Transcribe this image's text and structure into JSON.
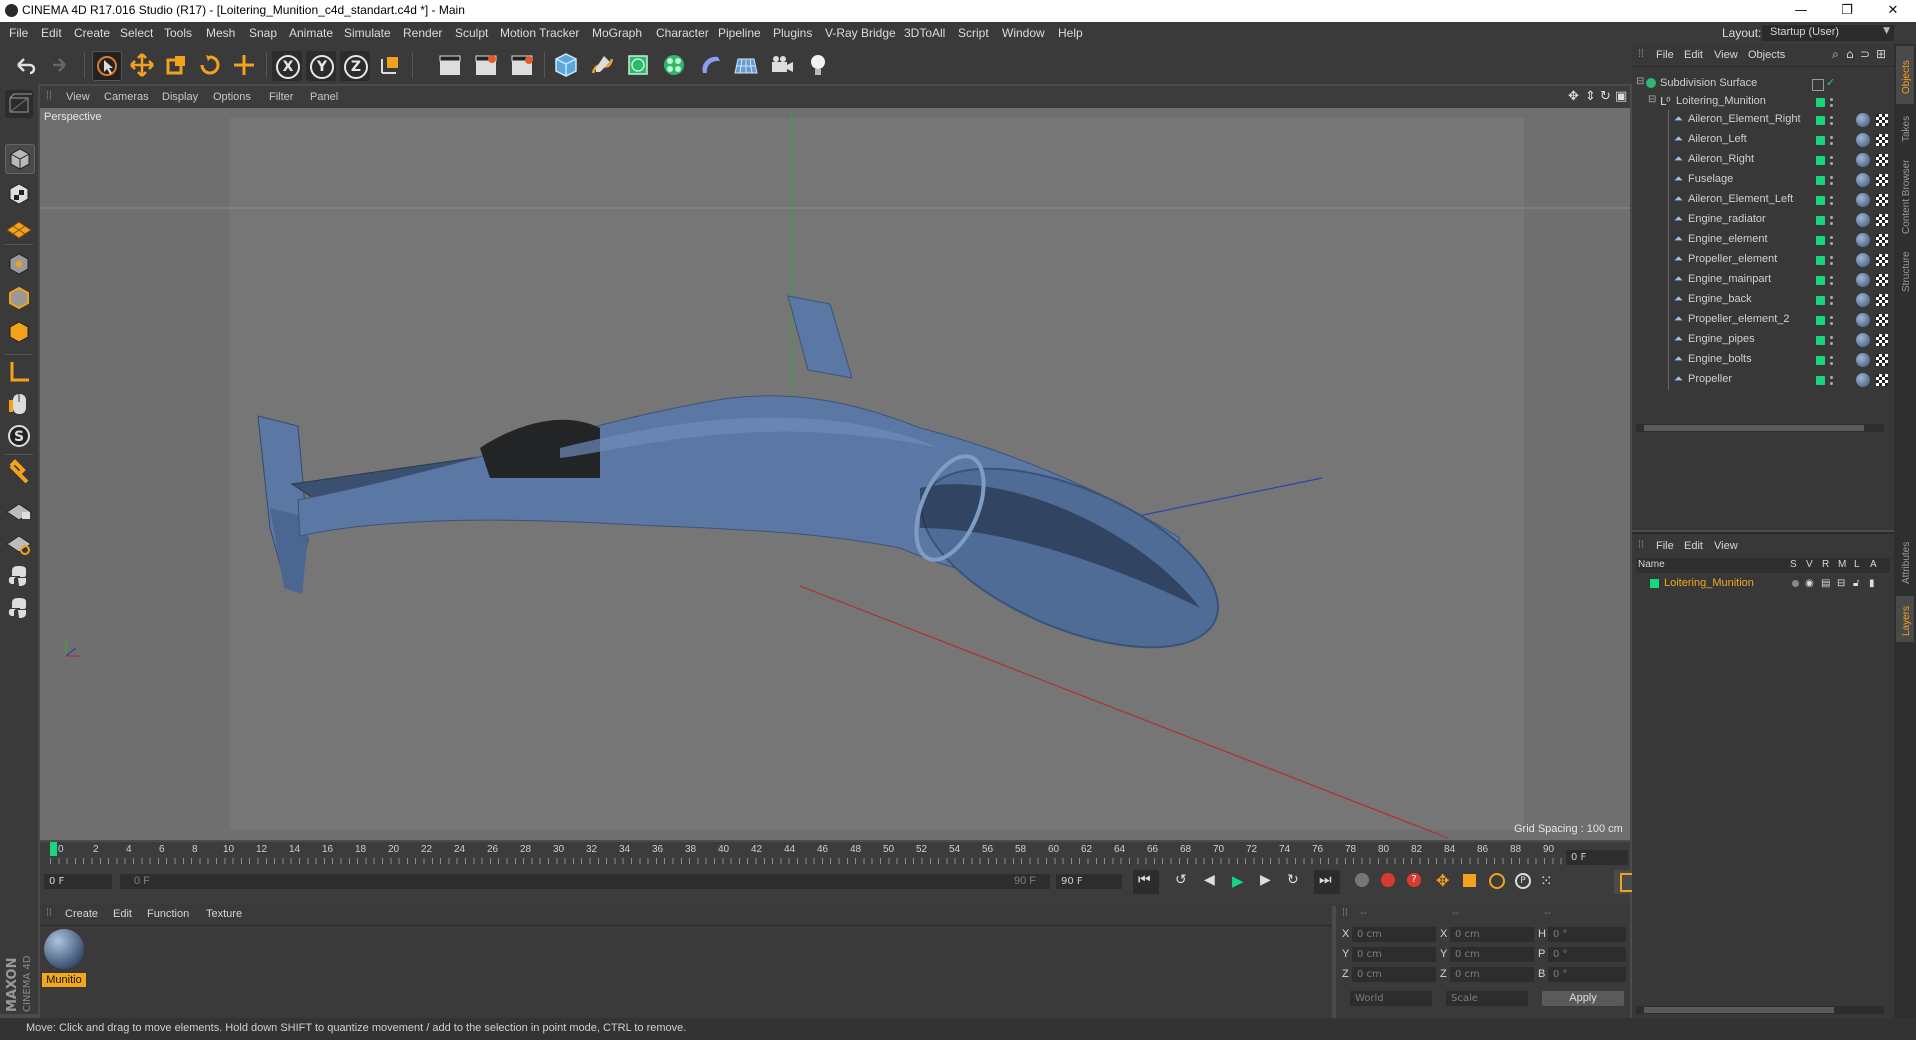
{
  "window": {
    "title": "CINEMA 4D R17.016 Studio (R17) - [Loitering_Munition_c4d_standart.c4d *] - Main",
    "controls": [
      "—",
      "❐",
      "✕"
    ]
  },
  "menubar": {
    "items": [
      "File",
      "Edit",
      "Create",
      "Select",
      "Tools",
      "Mesh",
      "Snap",
      "Animate",
      "Simulate",
      "Render",
      "Sculpt",
      "Motion Tracker",
      "MoGraph",
      "Character",
      "Pipeline",
      "Plugins",
      "V-Ray Bridge",
      "3DToAll",
      "Script",
      "Window",
      "Help"
    ],
    "layout_label": "Layout:",
    "layout_value": "Startup (User)"
  },
  "toolbar": {
    "axis_x": "X",
    "axis_y": "Y",
    "axis_z": "Z"
  },
  "viewport": {
    "menu": [
      "View",
      "Cameras",
      "Display",
      "Options",
      "Filter",
      "Panel"
    ],
    "label": "Perspective",
    "grid_spacing": "Grid Spacing : 100 cm"
  },
  "timeline": {
    "ticks": [
      "0",
      "2",
      "4",
      "6",
      "8",
      "10",
      "12",
      "14",
      "16",
      "18",
      "20",
      "22",
      "24",
      "26",
      "28",
      "30",
      "32",
      "34",
      "36",
      "38",
      "40",
      "42",
      "44",
      "46",
      "48",
      "50",
      "52",
      "54",
      "56",
      "58",
      "60",
      "62",
      "64",
      "66",
      "68",
      "70",
      "72",
      "74",
      "76",
      "78",
      "80",
      "82",
      "84",
      "86",
      "88",
      "90"
    ],
    "current_frame": "0 F",
    "start_frame": "0 F",
    "range_start": "0 F",
    "range_end": "90 F",
    "end_frame": "90 F"
  },
  "material_manager": {
    "menu": [
      "Create",
      "Edit",
      "Function",
      "Texture"
    ],
    "material_name": "Munitio"
  },
  "coordinates": {
    "headers": [
      "--",
      "--",
      "--"
    ],
    "rows": [
      {
        "a": "X",
        "av": "0 cm",
        "b": "X",
        "bv": "0 cm",
        "c": "H",
        "cv": "0 °"
      },
      {
        "a": "Y",
        "av": "0 cm",
        "b": "Y",
        "bv": "0 cm",
        "c": "P",
        "cv": "0 °"
      },
      {
        "a": "Z",
        "av": "0 cm",
        "b": "Z",
        "bv": "0 cm",
        "c": "B",
        "cv": "0 °"
      }
    ],
    "mode": "World",
    "scale": "Scale",
    "apply": "Apply"
  },
  "object_manager": {
    "menu": [
      "File",
      "Edit",
      "View",
      "Objects"
    ],
    "root": "Subdivision Surface",
    "group": "Loitering_Munition",
    "children": [
      "Aileron_Element_Right",
      "Aileron_Left",
      "Aileron_Right",
      "Fuselage",
      "Aileron_Element_Left",
      "Engine_radiator",
      "Engine_element",
      "Propeller_element",
      "Engine_mainpart",
      "Engine_back",
      "Propeller_element_2",
      "Engine_pipes",
      "Engine_bolts",
      "Propeller"
    ]
  },
  "layer_manager": {
    "menu": [
      "File",
      "Edit",
      "View"
    ],
    "name_header": "Name",
    "col_headers": [
      "S",
      "V",
      "R",
      "M",
      "L",
      "A"
    ],
    "layer_name": "Loitering_Munition"
  },
  "right_tabs": [
    "Objects",
    "Takes",
    "Content Browser",
    "Structure",
    "Attributes",
    "Layers"
  ],
  "status": "Move: Click and drag to move elements. Hold down SHIFT to quantize movement / add to the selection in point mode, CTRL to remove.",
  "brand": "MAXON CINEMA 4D",
  "colors": {
    "accent_green": "#16d77b",
    "layer_orange": "#f2a81d",
    "model_blue": "#5a78a3"
  }
}
